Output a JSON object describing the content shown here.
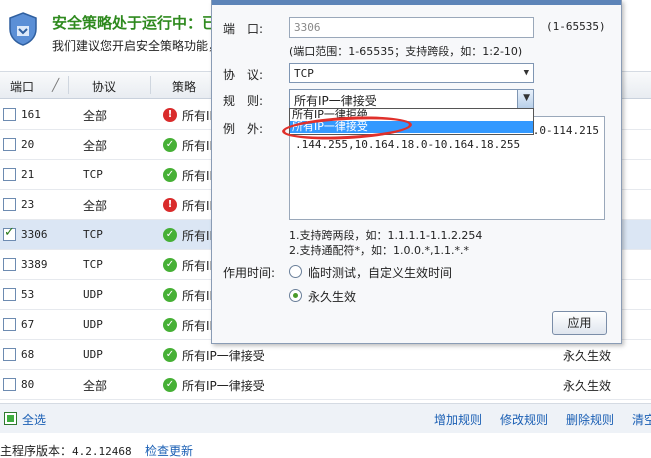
{
  "banner": {
    "title": "安全策略处于运行中：已",
    "subtitle": "我们建议您开启安全策略功能，"
  },
  "table": {
    "headers": {
      "port": "端口",
      "protocol": "协议",
      "strategy": "策略",
      "effect": ""
    },
    "rows": [
      {
        "port": "161",
        "protocol": "全部",
        "mono": false,
        "status": "err",
        "strategy": "所有IP",
        "effect": "",
        "checked": false,
        "selected": false
      },
      {
        "port": "20",
        "protocol": "全部",
        "mono": false,
        "status": "ok",
        "strategy": "所有IP",
        "effect": "",
        "checked": false,
        "selected": false
      },
      {
        "port": "21",
        "protocol": "TCP",
        "mono": true,
        "status": "ok",
        "strategy": "所有IP",
        "effect": "",
        "checked": false,
        "selected": false
      },
      {
        "port": "23",
        "protocol": "全部",
        "mono": false,
        "status": "err",
        "strategy": "所有IP",
        "effect": "",
        "checked": false,
        "selected": false
      },
      {
        "port": "3306",
        "protocol": "TCP",
        "mono": true,
        "status": "ok",
        "strategy": "所有IP",
        "effect": "",
        "checked": true,
        "selected": true
      },
      {
        "port": "3389",
        "protocol": "TCP",
        "mono": true,
        "status": "ok",
        "strategy": "所有IP",
        "effect": "",
        "checked": false,
        "selected": false
      },
      {
        "port": "53",
        "protocol": "UDP",
        "mono": true,
        "status": "ok",
        "strategy": "所有IP",
        "effect": "",
        "checked": false,
        "selected": false
      },
      {
        "port": "67",
        "protocol": "UDP",
        "mono": true,
        "status": "ok",
        "strategy": "所有IP",
        "effect": "",
        "checked": false,
        "selected": false
      },
      {
        "port": "68",
        "protocol": "UDP",
        "mono": true,
        "status": "ok",
        "strategy": "所有IP一律接受",
        "effect": "永久生效",
        "checked": false,
        "selected": false
      },
      {
        "port": "80",
        "protocol": "全部",
        "mono": false,
        "status": "ok",
        "strategy": "所有IP一律接受",
        "effect": "永久生效",
        "checked": false,
        "selected": false
      }
    ]
  },
  "footer": {
    "select_all": "全选",
    "add_rule": "增加规则",
    "edit_rule": "修改规则",
    "delete_rule": "删除规则",
    "clear": "清空"
  },
  "version": {
    "label": "主程序版本：",
    "number": "4.2.12468",
    "check_update": "检查更新"
  },
  "dialog": {
    "port_label": "端　口:",
    "port_value": "3306",
    "port_range": "(1-65535)",
    "port_hint": "(端口范围：1-65535；支持跨段，如：1:2-10)",
    "protocol_label": "协　议:",
    "protocol_value": "TCP",
    "rule_label": "规　则:",
    "rule_value": "所有IP一律接受",
    "rule_options": [
      "所有IP一律拒绝",
      "所有IP一律接受"
    ],
    "exception_label": "例　外:",
    "exception_line1": "4.0-114.215",
    "exception_line2": ".144.255,10.164.18.0-10.164.18.255",
    "tip1": "1.支持跨两段，如：1.1.1.1-1.1.2.254",
    "tip2": "2.支持通配符*，如：1.0.0.*,1.1.*.*",
    "time_label": "作用时间:",
    "time_option_temp": "临时测试，自定义生效时间",
    "time_option_perm": "永久生效",
    "apply_label": "应用"
  },
  "colors": {
    "accent": "#1a5fb4",
    "ok": "#46b035",
    "error": "#d92b2b",
    "highlight": "#3399ff",
    "annotation": "#e0302b"
  }
}
